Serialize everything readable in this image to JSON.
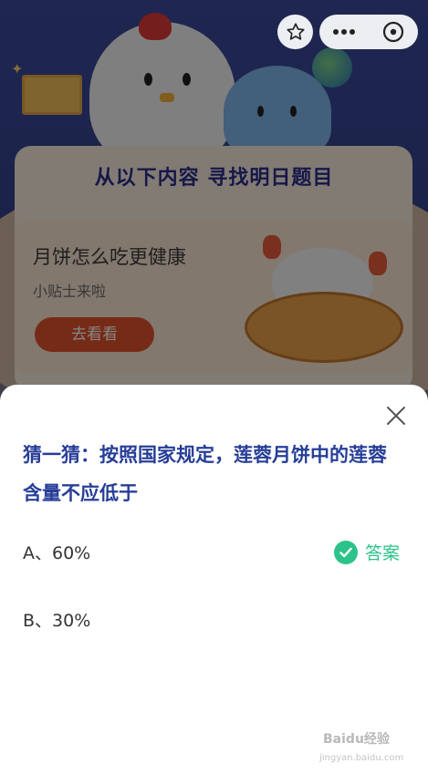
{
  "background": {
    "card_title": "从以下内容 寻找明日题目",
    "promo_title": "月饼怎么吃更健康",
    "promo_subtitle": "小贴士来啦",
    "promo_button": "去看看"
  },
  "topbar": {
    "icons": [
      "star-icon",
      "more-icon",
      "close-circle-icon"
    ]
  },
  "question": {
    "text": "猜一猜：按照国家规定，莲蓉月饼中的莲蓉含量不应低于",
    "options": [
      {
        "label": "A、60%",
        "is_answer": true
      },
      {
        "label": "B、30%",
        "is_answer": false
      }
    ],
    "answer_label": "答案"
  },
  "watermark": {
    "text": "Baidu经验",
    "sub": "jingyan.baidu.com"
  },
  "colors": {
    "question_text": "#273e98",
    "answer_green": "#2cc38a",
    "button_orange": "#e3542c"
  }
}
